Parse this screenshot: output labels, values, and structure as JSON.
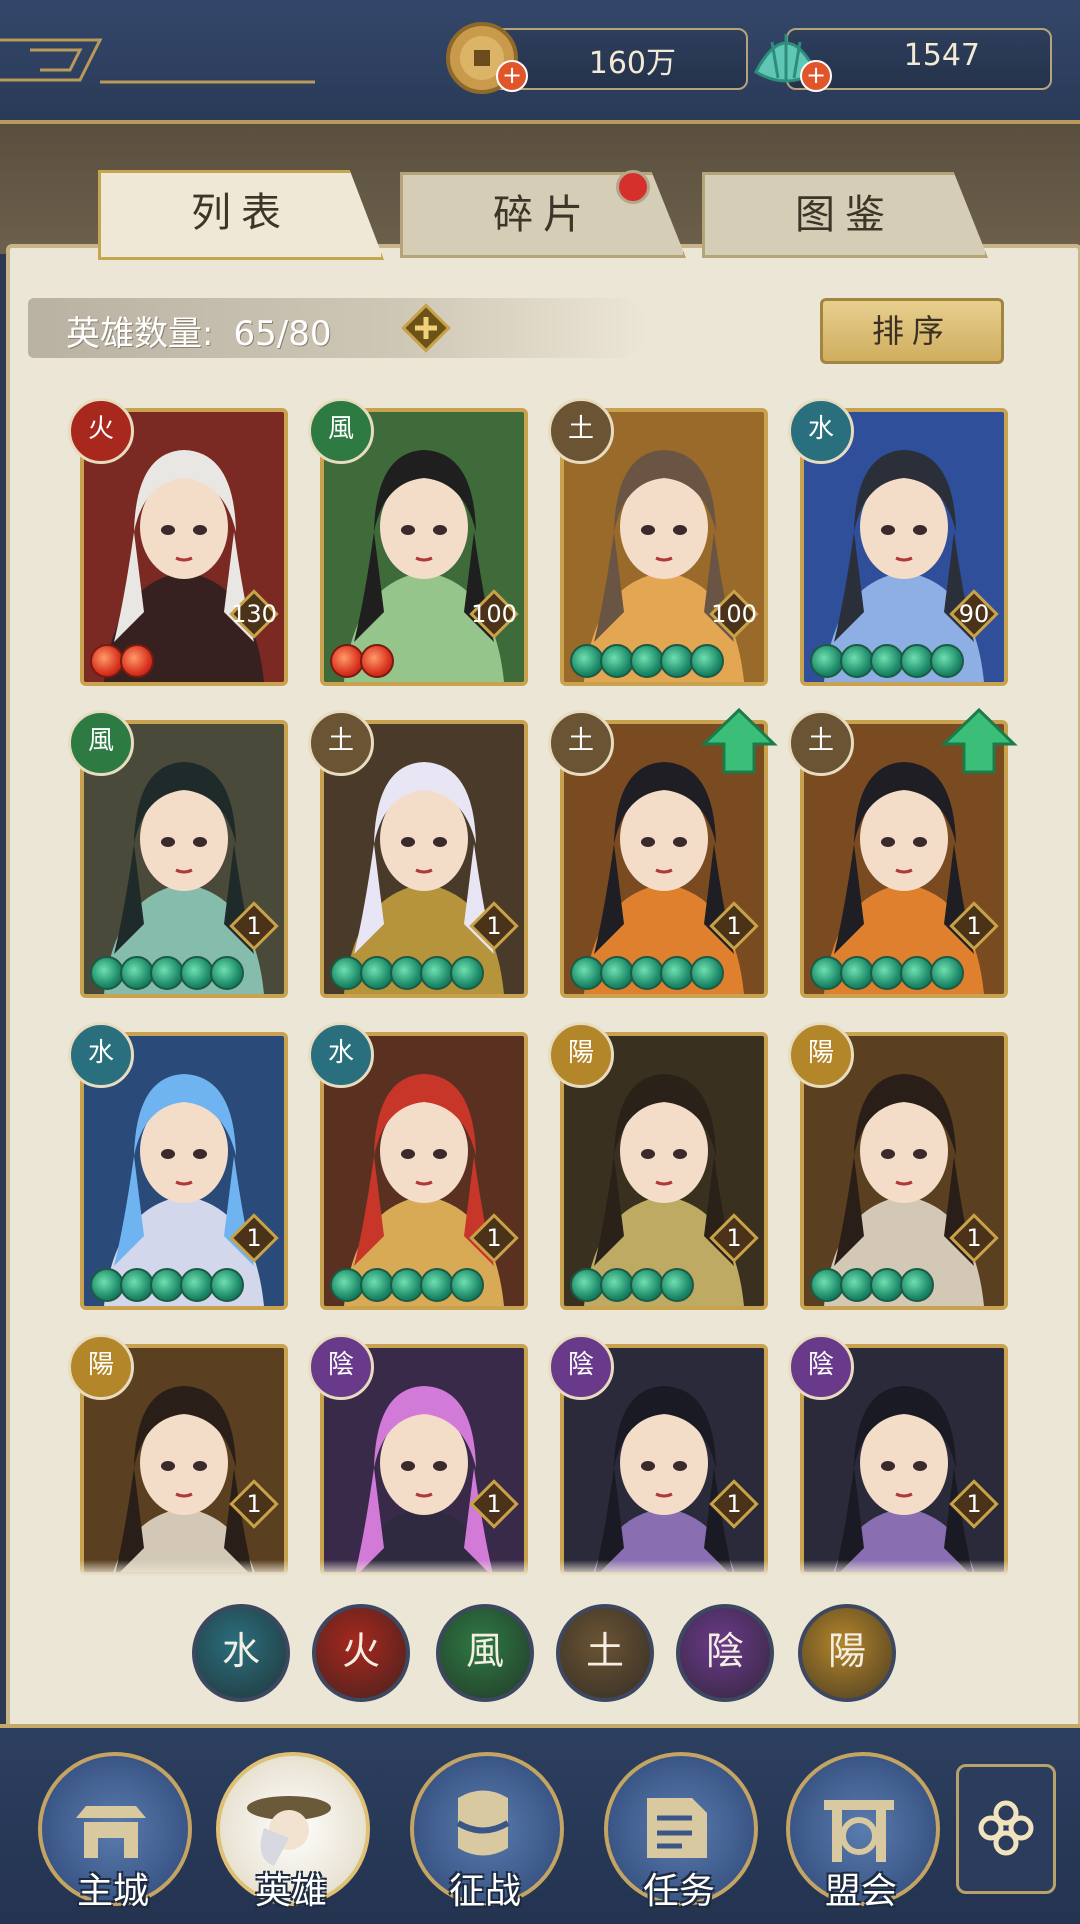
{
  "currencies": {
    "coins": {
      "value": "160万",
      "icon": "copper-coin-icon"
    },
    "gems": {
      "value": "1547",
      "icon": "jade-shell-icon"
    }
  },
  "tabs": [
    {
      "label": "列表",
      "active": true
    },
    {
      "label": "碎片",
      "active": false,
      "badge": true
    },
    {
      "label": "图鉴",
      "active": false
    }
  ],
  "hero_count": {
    "label": "英雄数量:",
    "value": "65/80"
  },
  "sort_label": "排序",
  "heroes": [
    {
      "element": "火",
      "level": "130",
      "stars": 2,
      "star_color": "red",
      "portrait": "white-haired-warrior"
    },
    {
      "element": "風",
      "level": "100",
      "stars": 2,
      "star_color": "red",
      "portrait": "green-robed-lady"
    },
    {
      "element": "土",
      "level": "100",
      "stars": 5,
      "star_color": "green",
      "portrait": "smiling-youth"
    },
    {
      "element": "水",
      "level": "90",
      "stars": 5,
      "star_color": "green",
      "portrait": "blue-opera-lady"
    },
    {
      "element": "風",
      "level": "1",
      "stars": 5,
      "star_color": "green",
      "portrait": "masked-archer"
    },
    {
      "element": "土",
      "level": "1",
      "stars": 5,
      "star_color": "green",
      "portrait": "white-haired-priestess"
    },
    {
      "element": "土",
      "level": "1",
      "stars": 5,
      "star_color": "green",
      "portrait": "fox-masked-lady",
      "upgrade": true
    },
    {
      "element": "土",
      "level": "1",
      "stars": 5,
      "star_color": "green",
      "portrait": "fox-masked-lady",
      "upgrade": true
    },
    {
      "element": "水",
      "level": "1",
      "stars": 5,
      "star_color": "green",
      "portrait": "blue-haired-maiden"
    },
    {
      "element": "水",
      "level": "1",
      "stars": 5,
      "star_color": "green",
      "portrait": "red-haired-dancer"
    },
    {
      "element": "陽",
      "level": "1",
      "stars": 4,
      "star_color": "green",
      "portrait": "black-robed-scholar"
    },
    {
      "element": "陽",
      "level": "1",
      "stars": 4,
      "star_color": "green",
      "portrait": "long-haired-swordsman"
    },
    {
      "element": "陽",
      "level": "1",
      "stars": 0,
      "star_color": "green",
      "portrait": "long-haired-swordsman"
    },
    {
      "element": "陰",
      "level": "1",
      "stars": 0,
      "star_color": "green",
      "portrait": "pink-haired-witch"
    },
    {
      "element": "陰",
      "level": "1",
      "stars": 0,
      "star_color": "green",
      "portrait": "dark-armored-lord"
    },
    {
      "element": "陰",
      "level": "1",
      "stars": 0,
      "star_color": "green",
      "portrait": "dark-armored-lord"
    }
  ],
  "element_filters": [
    "水",
    "火",
    "風",
    "土",
    "陰",
    "陽"
  ],
  "element_colors": {
    "火": "#a8281e",
    "風": "#2e7a43",
    "土": "#6b5434",
    "水": "#2a6f7e",
    "陽": "#b4862a",
    "陰": "#6a3a8a"
  },
  "nav": [
    {
      "label": "主城",
      "icon": "city-gate-icon",
      "active": false
    },
    {
      "label": "英雄",
      "icon": "hero-portrait-icon",
      "active": true
    },
    {
      "label": "征战",
      "icon": "war-drum-icon",
      "active": false
    },
    {
      "label": "任务",
      "icon": "scroll-quest-icon",
      "active": false
    },
    {
      "label": "盟会",
      "icon": "alliance-gate-icon",
      "active": false
    }
  ],
  "menu_icon": "flower-menu-icon"
}
